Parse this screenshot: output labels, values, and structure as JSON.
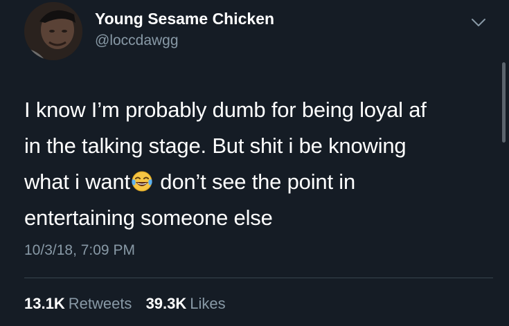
{
  "tweet": {
    "author": {
      "display_name": "Young Sesame Chicken",
      "handle": "@loccdawgg"
    },
    "text_lines": [
      "I know I’m probably dumb for being loyal af",
      "in the talking stage. But shit i be knowing",
      "what i want",
      " don’t see the point in",
      "entertaining someone else"
    ],
    "emoji": "face-with-tears-of-joy",
    "timestamp": "10/3/18, 7:09 PM",
    "stats": {
      "retweets_count": "13.1K",
      "retweets_label": "Retweets",
      "likes_count": "39.3K",
      "likes_label": "Likes"
    }
  },
  "colors": {
    "background": "#151c25",
    "secondary_text": "#8899a6",
    "divider": "#38444d"
  }
}
